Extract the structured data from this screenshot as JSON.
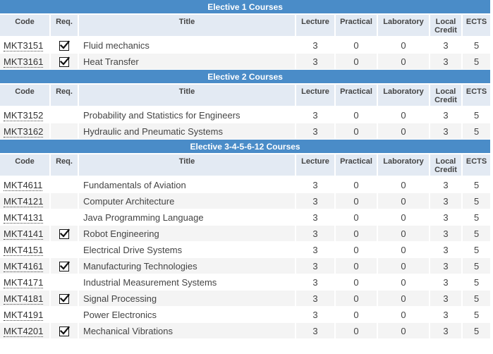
{
  "columns": {
    "code": "Code",
    "req": "Req.",
    "title": "Title",
    "lecture": "Lecture",
    "practical": "Practical",
    "laboratory": "Laboratory",
    "local_credit_1": "Local",
    "local_credit_2": "Credit",
    "ects": "ECTS"
  },
  "sections": [
    {
      "title": "Elective 1 Courses",
      "rows": [
        {
          "code": "MKT3151",
          "req": true,
          "title": "Fluid mechanics",
          "lecture": "3",
          "practical": "0",
          "laboratory": "0",
          "credit": "3",
          "ects": "5"
        },
        {
          "code": "MKT3161",
          "req": true,
          "title": "Heat Transfer",
          "lecture": "3",
          "practical": "0",
          "laboratory": "0",
          "credit": "3",
          "ects": "5"
        }
      ]
    },
    {
      "title": "Elective 2 Courses",
      "rows": [
        {
          "code": "MKT3152",
          "req": false,
          "title": "Probability and Statistics for Engineers",
          "lecture": "3",
          "practical": "0",
          "laboratory": "0",
          "credit": "3",
          "ects": "5"
        },
        {
          "code": "MKT3162",
          "req": false,
          "title": "Hydraulic and Pneumatic Systems",
          "lecture": "3",
          "practical": "0",
          "laboratory": "0",
          "credit": "3",
          "ects": "5"
        }
      ]
    },
    {
      "title": "Elective 3-4-5-6-12 Courses",
      "rows": [
        {
          "code": "MKT4611",
          "req": false,
          "title": "Fundamentals of Aviation",
          "lecture": "3",
          "practical": "0",
          "laboratory": "0",
          "credit": "3",
          "ects": "5"
        },
        {
          "code": "MKT4121",
          "req": false,
          "title": "Computer Architecture",
          "lecture": "3",
          "practical": "0",
          "laboratory": "0",
          "credit": "3",
          "ects": "5"
        },
        {
          "code": "MKT4131",
          "req": false,
          "title": "Java Programming Language",
          "lecture": "3",
          "practical": "0",
          "laboratory": "0",
          "credit": "3",
          "ects": "5"
        },
        {
          "code": "MKT4141",
          "req": true,
          "title": "Robot Engineering",
          "lecture": "3",
          "practical": "0",
          "laboratory": "0",
          "credit": "3",
          "ects": "5"
        },
        {
          "code": "MKT4151",
          "req": false,
          "title": "Electrical Drive Systems",
          "lecture": "3",
          "practical": "0",
          "laboratory": "0",
          "credit": "3",
          "ects": "5"
        },
        {
          "code": "MKT4161",
          "req": true,
          "title": "Manufacturing Technologies",
          "lecture": "3",
          "practical": "0",
          "laboratory": "0",
          "credit": "3",
          "ects": "5"
        },
        {
          "code": "MKT4171",
          "req": false,
          "title": "Industrial Measurement Systems",
          "lecture": "3",
          "practical": "0",
          "laboratory": "0",
          "credit": "3",
          "ects": "5"
        },
        {
          "code": "MKT4181",
          "req": true,
          "title": "Signal Processing",
          "lecture": "3",
          "practical": "0",
          "laboratory": "0",
          "credit": "3",
          "ects": "5"
        },
        {
          "code": "MKT4191",
          "req": false,
          "title": "Power Electronics",
          "lecture": "3",
          "practical": "0",
          "laboratory": "0",
          "credit": "3",
          "ects": "5"
        },
        {
          "code": "MKT4201",
          "req": true,
          "title": "Mechanical Vibrations",
          "lecture": "3",
          "practical": "0",
          "laboratory": "0",
          "credit": "3",
          "ects": "5"
        }
      ]
    }
  ],
  "colors": {
    "section_header": "#4a8cc8",
    "column_header": "#e3eaf3",
    "alt_row": "#f4f4f4"
  },
  "icons": {
    "required": "checked-checkbox-icon"
  }
}
